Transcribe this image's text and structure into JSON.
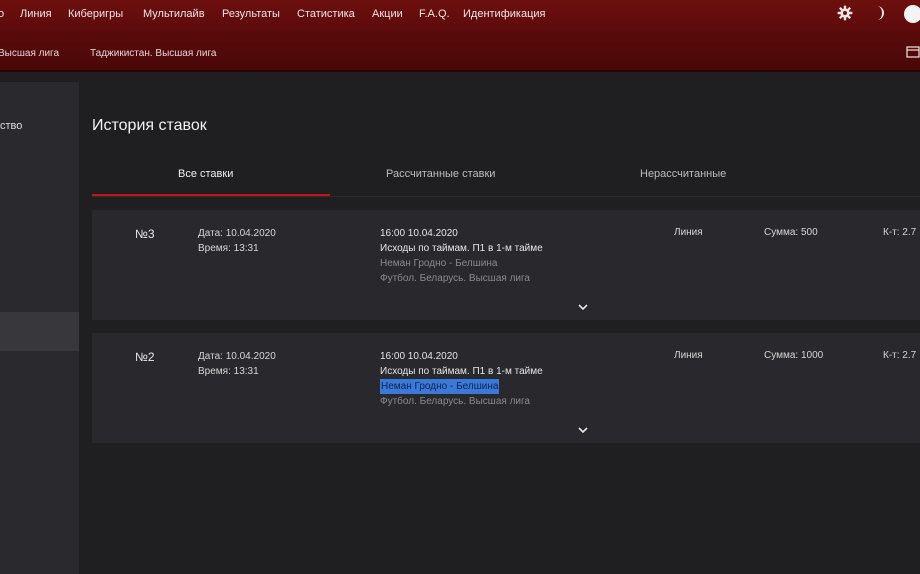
{
  "topnav": {
    "items": [
      "о",
      "Линия",
      "Киберигры",
      "Мультилайв",
      "Результаты",
      "Статистика",
      "Акции",
      "F.A.Q.",
      "Идентификация"
    ],
    "icons": [
      "gear-icon",
      "moon-icon",
      "avatar-icon"
    ]
  },
  "subnav": {
    "items": [
      "Высшая лига",
      "Таджикистан. Высшая лига"
    ],
    "icons": [
      "expand-icon"
    ]
  },
  "sidebar": {
    "label": "ство"
  },
  "page": {
    "title": "История ставок"
  },
  "tabs": [
    "Все ставки",
    "Рассчитанные ставки",
    "Нерассчитанные"
  ],
  "bets": [
    {
      "number": "№3",
      "date": "Дата: 10.04.2020",
      "time": "Время: 13:31",
      "event_time": "16:00 10.04.2020",
      "market": "Исходы по таймам. П1 в 1-м тайме",
      "match": "Неман Гродно - Белшина",
      "league": "Футбол. Беларусь. Высшая лига",
      "type": "Линия",
      "sum": "Сумма: 500",
      "coef": "К-т: 2.7",
      "highlighted": false
    },
    {
      "number": "№2",
      "date": "Дата: 10.04.2020",
      "time": "Время: 13:31",
      "event_time": "16:00 10.04.2020",
      "market": "Исходы по таймам. П1 в 1-м тайме",
      "match": "Неман Гродно - Белшина",
      "league": "Футбол. Беларусь. Высшая лига",
      "type": "Линия",
      "sum": "Сумма: 1000",
      "coef": "К-т: 2.7",
      "highlighted": true
    }
  ],
  "colors": {
    "header": "#6d0f0f",
    "accent": "#c21616",
    "background": "#1f1e21",
    "card": "#29282c",
    "selection": "#3b78d8"
  }
}
